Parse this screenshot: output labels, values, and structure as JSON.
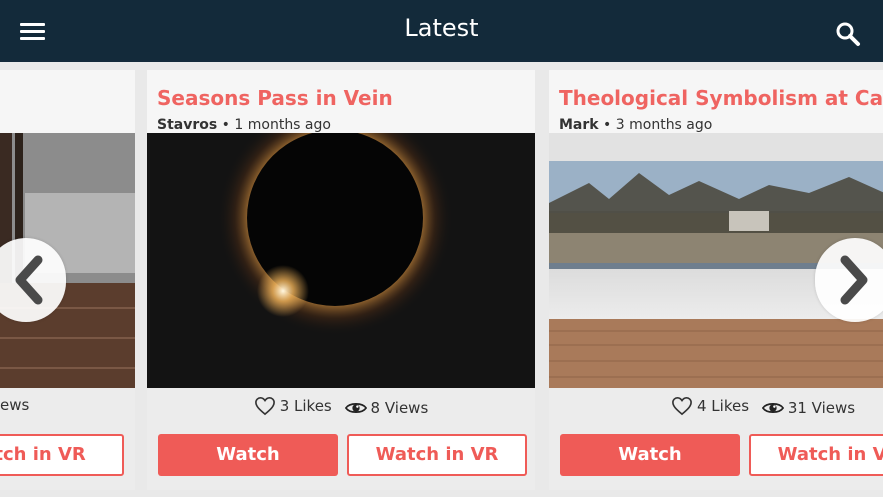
{
  "header": {
    "title": "Latest"
  },
  "cards": [
    {
      "title": "",
      "author": "",
      "time": "",
      "likes": "",
      "views_fragment": "ews",
      "watch_label": "",
      "vr_label": "atch in VR"
    },
    {
      "title": "Seasons Pass in Vein",
      "author": "Stavros",
      "time": "1 months ago",
      "likes": "3 Likes",
      "views": "8 Views",
      "watch_label": "Watch",
      "vr_label": "Watch in VR"
    },
    {
      "title": "Theological Symbolism at Calvary C",
      "author": "Mark",
      "time": "3 months ago",
      "likes": "4 Likes",
      "views": "31 Views",
      "watch_label": "Watch",
      "vr_label": "Watch in VR"
    }
  ],
  "icons": {
    "menu": "hamburger-menu-icon",
    "search": "search-icon",
    "like": "heart-icon",
    "views": "eye-icon",
    "prev": "chevron-left-icon",
    "next": "chevron-right-icon"
  },
  "colors": {
    "header_bg": "#132a3a",
    "accent": "#ef5b57",
    "title": "#ef6461"
  }
}
